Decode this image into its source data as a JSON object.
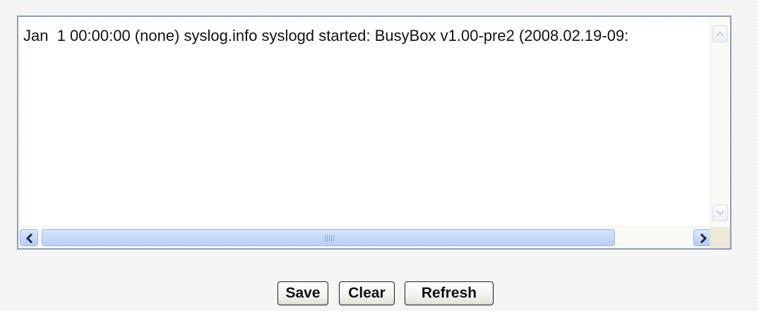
{
  "log": {
    "text": "Jan  1 00:00:00 (none) syslog.info syslogd started: BusyBox v1.00-pre2 (2008.02.19-09:"
  },
  "scrollbars": {
    "vertical_up_icon": "chevron-up-icon",
    "vertical_down_icon": "chevron-down-icon",
    "horizontal_left_icon": "chevron-left-icon",
    "horizontal_right_icon": "chevron-right-icon",
    "horizontal_position": 0,
    "accent_color": "#b8cff5"
  },
  "buttons": {
    "save": "Save",
    "clear": "Clear",
    "refresh": "Refresh"
  }
}
